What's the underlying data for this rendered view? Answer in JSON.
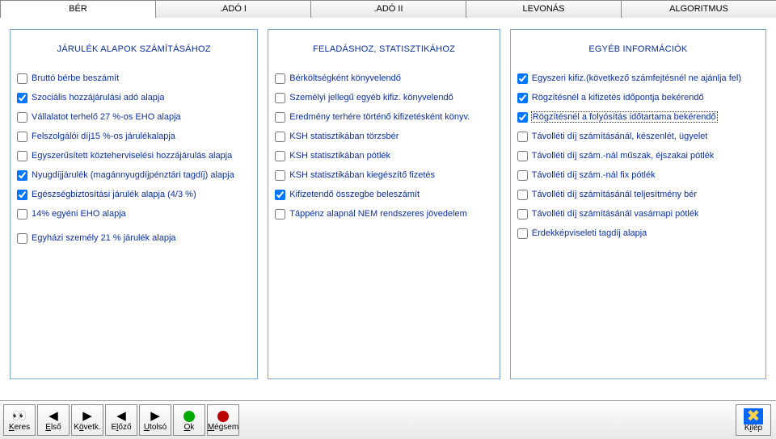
{
  "tabs": {
    "t0": "BÉR",
    "t1": ".ADÓ I",
    "t2": ".ADÓ II",
    "t3": "LEVONÁS",
    "t4": "ALGORITMUS"
  },
  "panels": {
    "p1": {
      "title": "JÁRULÉK ALAPOK SZÁMÍTÁSÁHOZ",
      "items": [
        {
          "label": "Bruttó bérbe beszámít",
          "checked": false
        },
        {
          "label": "Szociális hozzájárulási adó alapja",
          "checked": true
        },
        {
          "label": "Vállalatot terhelő 27 %-os EHO alapja",
          "checked": false
        },
        {
          "label": "Felszolgálói díj15 %-os járulékalapja",
          "checked": false
        },
        {
          "label": "Egyszerűsített közteherviselési hozzájárulás alapja",
          "checked": false
        },
        {
          "label": "Nyugdíjjárulék (magánnyugdíjpénztári tagdíj) alapja",
          "checked": true
        },
        {
          "label": "Egészségbiztosítási járulék alapja (4/3 %)",
          "checked": true
        },
        {
          "label": "14% egyéni EHO alapja",
          "checked": false
        }
      ],
      "extra": {
        "label": "Egyházi személy 21 % járulék alapja",
        "checked": false
      }
    },
    "p2": {
      "title": "FELADÁSHOZ, STATISZTIKÁHOZ",
      "items": [
        {
          "label": "Bérköltségként könyvelendő",
          "checked": false
        },
        {
          "label": "Személyi jellegű egyéb kifiz. könyvelendő",
          "checked": false
        },
        {
          "label": "Eredmény terhére történő kifizetésként könyv.",
          "checked": false
        },
        {
          "label": "KSH statisztikában törzsbér",
          "checked": false
        },
        {
          "label": "KSH statisztikában pótlék",
          "checked": false
        },
        {
          "label": "KSH statisztikában kiegészítő fizetés",
          "checked": false
        },
        {
          "label": "Kifizetendő összegbe beleszámít",
          "checked": true
        },
        {
          "label": "Táppénz alapnál NEM rendszeres jövedelem",
          "checked": false
        }
      ]
    },
    "p3": {
      "title": "EGYÉB INFORMÁCIÓK",
      "items": [
        {
          "label": "Egyszeri kifiz.(következő számfejtésnél ne ajánlja fel)",
          "checked": true
        },
        {
          "label": "Rögzítésnél a kifizetés időpontja bekérendő",
          "checked": true
        },
        {
          "label": "Rögzítésnél a folyósítás időtartama bekérendő",
          "checked": true,
          "focused": true
        },
        {
          "label": "Távolléti díj számításánál, készenlét, ügyelet",
          "checked": false
        },
        {
          "label": "Távolléti díj szám.-nál műszak, éjszakai pótlék",
          "checked": false
        },
        {
          "label": "Távolléti díj szám.-nál fix pótlék",
          "checked": false
        },
        {
          "label": "Távolléti díj számításánál teljesítmény bér",
          "checked": false
        },
        {
          "label": "Távolléti díj számításánál vasárnapi pótlék",
          "checked": false
        },
        {
          "label": "Érdekképviseleti tagdíj alapja",
          "checked": false
        }
      ]
    }
  },
  "toolbar": {
    "keres": "Keres",
    "elso": "Első",
    "kovetk": "Követk.",
    "elozo": "Előző",
    "utolso": "Utolsó",
    "ok": "Ok",
    "megsem": "Mégsem",
    "kilep": "Kilép"
  }
}
